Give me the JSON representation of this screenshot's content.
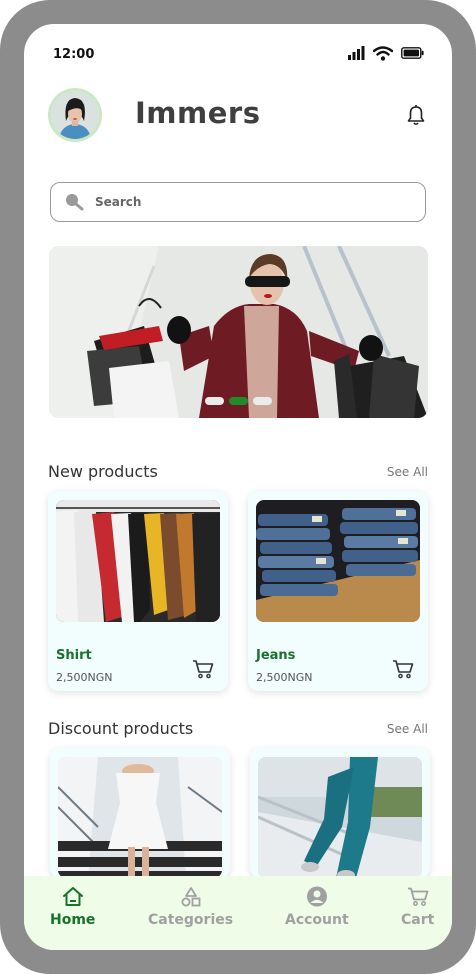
{
  "status_bar": {
    "time": "12:00"
  },
  "header": {
    "brand": "Immers"
  },
  "search": {
    "placeholder": "Search"
  },
  "banner": {
    "slides": 3,
    "active_slide": 2
  },
  "sections": {
    "new_products": {
      "title": "New products",
      "see_all": "See All"
    },
    "discount_products": {
      "title": "Discount products",
      "see_all": "See All"
    }
  },
  "new_products": [
    {
      "name": "Shirt",
      "price": "2,500NGN"
    },
    {
      "name": "Jeans",
      "price": "2,500NGN"
    }
  ],
  "bottom_nav": [
    {
      "label": "Home",
      "icon": "home-icon",
      "active": true
    },
    {
      "label": "Categories",
      "icon": "categories-icon",
      "active": false
    },
    {
      "label": "Account",
      "icon": "account-icon",
      "active": false
    },
    {
      "label": "Cart",
      "icon": "cart-icon",
      "active": false
    }
  ],
  "colors": {
    "accent": "#17722a",
    "nav_bg": "#eefce8",
    "card_bg": "#f2fdfd"
  }
}
